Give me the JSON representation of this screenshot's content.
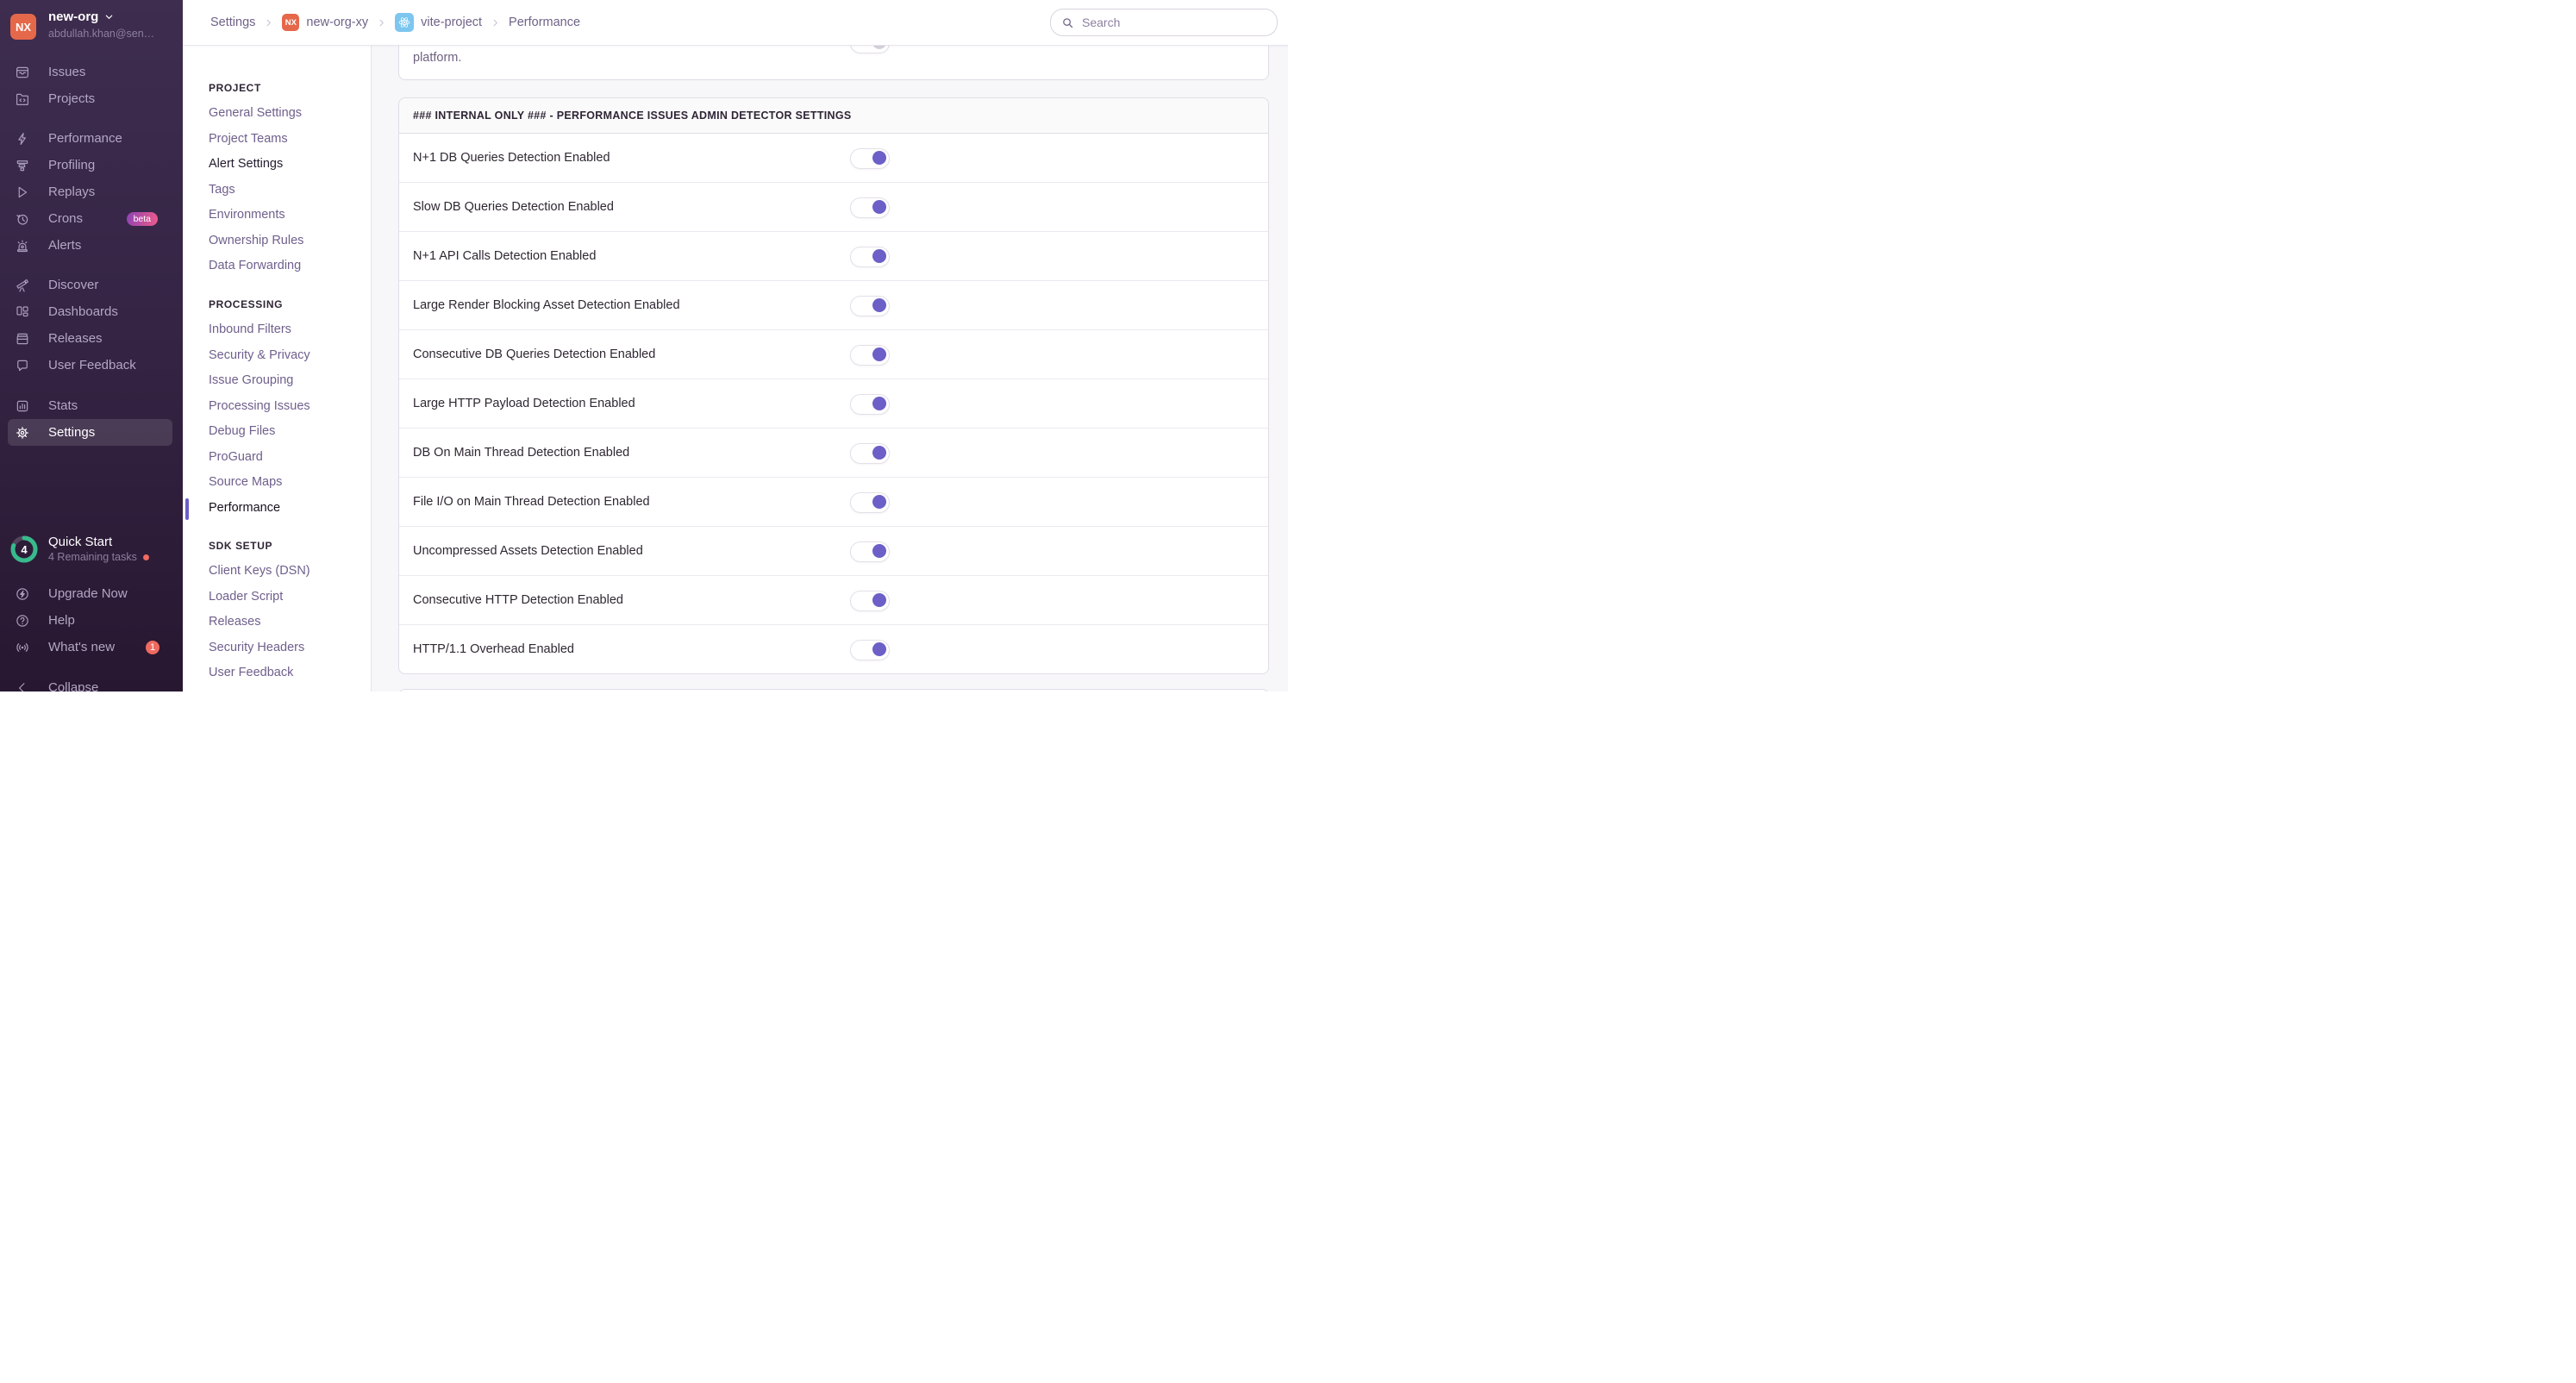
{
  "app": {
    "search_placeholder": "Search"
  },
  "colors": {
    "accent": "#6C5FC7",
    "sidebar_top": "#3e2d4f",
    "sidebar_bottom": "#271730",
    "avatar_orange": "#e5684b",
    "react_blue": "#7cc6ef",
    "salmon_badge": "#ef6a60",
    "quickstart_teal": "#38ba8c",
    "beta_gradient_from": "#8e44b4",
    "beta_gradient_to": "#ef5a8a"
  },
  "sidebar": {
    "org": {
      "initials": "NX",
      "name": "new-org",
      "email": "abdullah.khan@sen…"
    },
    "groups": [
      [
        {
          "label": "Issues",
          "icon": "issues-icon"
        },
        {
          "label": "Projects",
          "icon": "projects-icon"
        }
      ],
      [
        {
          "label": "Performance",
          "icon": "performance-icon"
        },
        {
          "label": "Profiling",
          "icon": "profiling-icon"
        },
        {
          "label": "Replays",
          "icon": "replays-icon"
        },
        {
          "label": "Crons",
          "icon": "crons-icon",
          "beta": "beta"
        },
        {
          "label": "Alerts",
          "icon": "alerts-icon"
        }
      ],
      [
        {
          "label": "Discover",
          "icon": "discover-icon"
        },
        {
          "label": "Dashboards",
          "icon": "dashboards-icon"
        },
        {
          "label": "Releases",
          "icon": "releases-icon"
        },
        {
          "label": "User Feedback",
          "icon": "user-feedback-icon"
        }
      ],
      [
        {
          "label": "Stats",
          "icon": "stats-icon"
        },
        {
          "label": "Settings",
          "icon": "settings-icon",
          "active": true
        }
      ]
    ],
    "quickstart": {
      "title": "Quick Start",
      "subtitle": "4 Remaining tasks",
      "count": "4",
      "progress_fraction": 0.8
    },
    "footer": [
      {
        "label": "Upgrade Now",
        "icon": "upgrade-icon"
      },
      {
        "label": "Help",
        "icon": "help-icon"
      },
      {
        "label": "What's new",
        "icon": "whats-new-icon",
        "badge": "1"
      }
    ],
    "collapse": {
      "label": "Collapse",
      "icon": "collapse-icon"
    }
  },
  "breadcrumb": {
    "items": [
      {
        "label": "Settings"
      },
      {
        "label": "new-org-xy",
        "badge": "nx",
        "badge_text": "NX"
      },
      {
        "label": "vite-project",
        "badge": "react"
      },
      {
        "label": "Performance"
      }
    ]
  },
  "settings_nav": {
    "sections": [
      {
        "title": "PROJECT",
        "items": [
          {
            "label": "General Settings"
          },
          {
            "label": "Project Teams"
          },
          {
            "label": "Alert Settings",
            "emphasis": true
          },
          {
            "label": "Tags"
          },
          {
            "label": "Environments"
          },
          {
            "label": "Ownership Rules"
          },
          {
            "label": "Data Forwarding"
          }
        ]
      },
      {
        "title": "PROCESSING",
        "items": [
          {
            "label": "Inbound Filters"
          },
          {
            "label": "Security & Privacy"
          },
          {
            "label": "Issue Grouping"
          },
          {
            "label": "Processing Issues"
          },
          {
            "label": "Debug Files"
          },
          {
            "label": "ProGuard"
          },
          {
            "label": "Source Maps"
          },
          {
            "label": "Performance",
            "active": true
          }
        ]
      },
      {
        "title": "SDK SETUP",
        "items": [
          {
            "label": "Client Keys (DSN)"
          },
          {
            "label": "Loader Script"
          },
          {
            "label": "Releases"
          },
          {
            "label": "Security Headers"
          },
          {
            "label": "User Feedback"
          }
        ]
      }
    ]
  },
  "content": {
    "top_partial": {
      "description_tail": "platform.",
      "toggle_state": "partially-hidden"
    },
    "panel": {
      "header": "### INTERNAL ONLY ### - PERFORMANCE ISSUES ADMIN DETECTOR SETTINGS",
      "rows": [
        {
          "label": "N+1 DB Queries Detection Enabled",
          "enabled": true
        },
        {
          "label": "Slow DB Queries Detection Enabled",
          "enabled": true
        },
        {
          "label": "N+1 API Calls Detection Enabled",
          "enabled": true
        },
        {
          "label": "Large Render Blocking Asset Detection Enabled",
          "enabled": true
        },
        {
          "label": "Consecutive DB Queries Detection Enabled",
          "enabled": true
        },
        {
          "label": "Large HTTP Payload Detection Enabled",
          "enabled": true
        },
        {
          "label": "DB On Main Thread Detection Enabled",
          "enabled": true
        },
        {
          "label": "File I/O on Main Thread Detection Enabled",
          "enabled": true
        },
        {
          "label": "Uncompressed Assets Detection Enabled",
          "enabled": true
        },
        {
          "label": "Consecutive HTTP Detection Enabled",
          "enabled": true
        },
        {
          "label": "HTTP/1.1 Overhead Enabled",
          "enabled": true
        }
      ]
    }
  }
}
